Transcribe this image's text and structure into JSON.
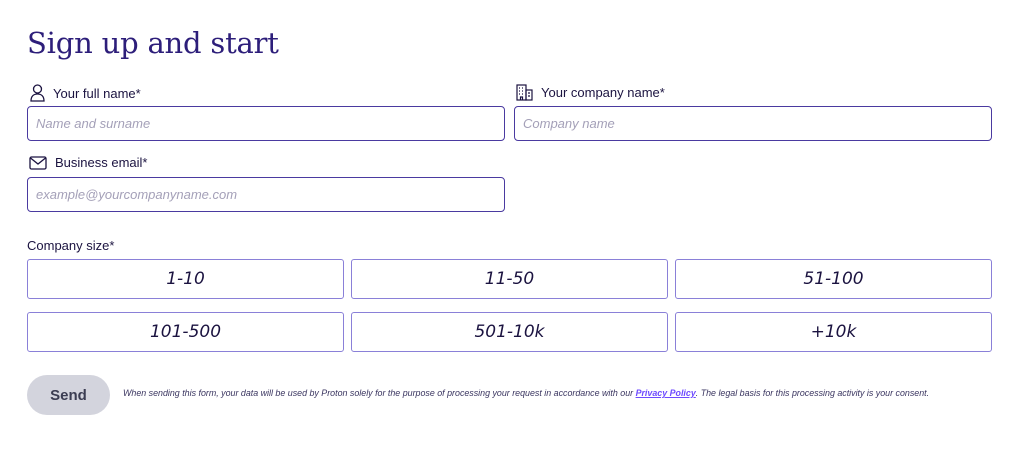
{
  "form": {
    "title": "Sign up and start",
    "full_name": {
      "label": "Your full name*",
      "placeholder": "Name and surname",
      "icon": "user-icon"
    },
    "company_name": {
      "label": "Your company name*",
      "placeholder": "Company name",
      "icon": "building-icon"
    },
    "email": {
      "label": "Business email*",
      "placeholder": "example@yourcompanyname.com",
      "icon": "mail-icon"
    },
    "company_size": {
      "label": "Company size*",
      "options": [
        "1-10",
        "11-50",
        "51-100",
        "101-500",
        "501-10k",
        "+10k"
      ]
    },
    "send_label": "Send",
    "disclaimer": {
      "before": "When sending this form, your data will be used by Proton solely for the purpose of processing your request in accordance with our ",
      "link": "Privacy Policy",
      "after": ". The legal basis for this processing activity is your consent."
    }
  },
  "colors": {
    "title": "#2d1e7a",
    "input_border": "#4a3aa0",
    "option_border": "#8a80d8",
    "send_bg": "#d3d4dd",
    "link": "#6d4aff"
  }
}
